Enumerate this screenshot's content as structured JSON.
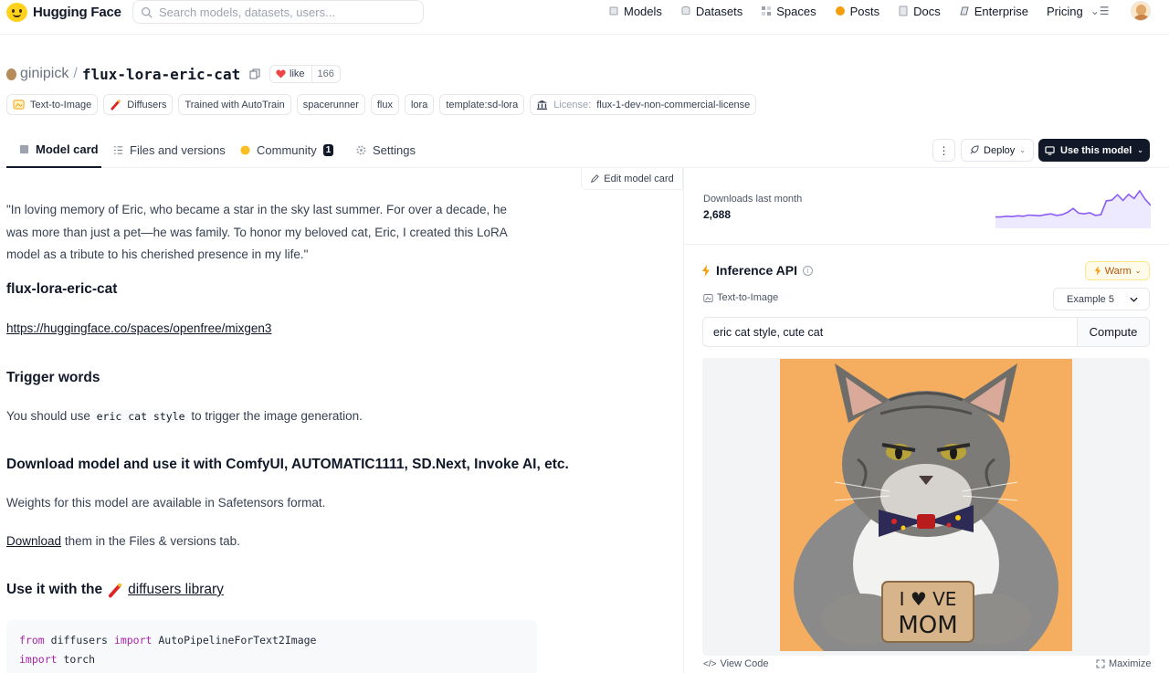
{
  "nav": {
    "brand": "Hugging Face",
    "search_placeholder": "Search models, datasets, users...",
    "links": [
      "Models",
      "Datasets",
      "Spaces",
      "Posts",
      "Docs",
      "Enterprise",
      "Pricing"
    ]
  },
  "repo": {
    "owner": "ginipick",
    "name": "flux-lora-eric-cat",
    "like_label": "like",
    "like_count": "166"
  },
  "tags": {
    "t1": "Text-to-Image",
    "t2": "Diffusers",
    "t3": "Trained with AutoTrain",
    "t4": "spacerunner",
    "t5": "flux",
    "t6": "lora",
    "t7": "template:sd-lora",
    "license_label": "License:",
    "license_value": "flux-1-dev-non-commercial-license"
  },
  "tabs": {
    "model_card": "Model card",
    "files": "Files and versions",
    "community": "Community",
    "community_count": "1",
    "settings": "Settings",
    "deploy": "Deploy",
    "use_model": "Use this model"
  },
  "card": {
    "edit": "Edit model card",
    "quote": "\"In loving memory of Eric, who became a star in the sky last summer. For over a decade, he was more than just a pet—he was family. To honor my beloved cat, Eric, I created this LoRA model as a tribute to his cherished presence in my life.\"",
    "title": "flux-lora-eric-cat",
    "space_link": "https://huggingface.co/spaces/openfree/mixgen3",
    "trigger_heading": "Trigger words",
    "trigger_pre": "You should use",
    "trigger_code": "eric cat style",
    "trigger_post": "to trigger the image generation.",
    "download_heading": "Download model and use it with ComfyUI, AUTOMATIC1111, SD.Next, Invoke AI, etc.",
    "weights_text": "Weights for this model are available in Safetensors format.",
    "download_link": "Download",
    "download_post": "them in the Files & versions tab.",
    "use_heading_pre": "Use it with the",
    "use_heading_link": "diffusers library",
    "code_line1_kw1": "from",
    "code_line1_mid": "diffusers",
    "code_line1_kw2": "import",
    "code_line1_end": "AutoPipelineForText2Image",
    "code_line2_kw": "import",
    "code_line2_end": "torch"
  },
  "downloads": {
    "label": "Downloads last month",
    "count": "2,688",
    "spark": [
      2,
      2,
      2.2,
      2.1,
      2.3,
      2.2,
      2.5,
      2.4,
      2.3,
      2.6,
      2.8,
      2.4,
      2.6,
      3.2,
      4.2,
      3.0,
      2.8,
      3.1,
      2.4,
      2.6,
      6.2,
      6.4,
      7.8,
      6.3,
      7.9,
      6.8,
      8.8,
      6.6,
      5.0
    ]
  },
  "inference": {
    "title": "Inference API",
    "status": "Warm",
    "task": "Text-to-Image",
    "example": "Example 5",
    "prompt": "eric cat style, cute cat",
    "compute": "Compute",
    "view_code": "View Code",
    "maximize": "Maximize",
    "sign_text": "I LOVE MOM"
  },
  "colors": {
    "accent": "#111827",
    "spark": "#8b5cf6",
    "warm": "#b45309",
    "image_bg": "#f5ae5f"
  }
}
